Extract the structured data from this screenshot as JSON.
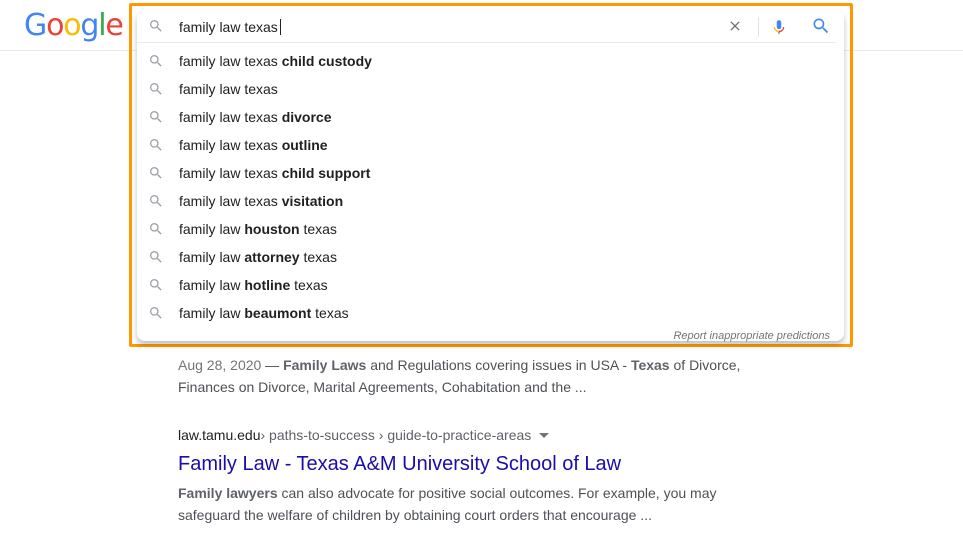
{
  "logo": {
    "text": "Google",
    "letters": [
      "G",
      "o",
      "o",
      "g",
      "l",
      "e"
    ]
  },
  "search": {
    "query": "family law texas ",
    "clear_icon": "close-icon",
    "voice_icon": "mic-icon",
    "submit_icon": "search-icon"
  },
  "suggestions": [
    {
      "prefix": "family law texas ",
      "bold": "child custody",
      "suffix": ""
    },
    {
      "prefix": "family law texas",
      "bold": "",
      "suffix": ""
    },
    {
      "prefix": "family law texas ",
      "bold": "divorce",
      "suffix": ""
    },
    {
      "prefix": "family law texas ",
      "bold": "outline",
      "suffix": ""
    },
    {
      "prefix": "family law texas ",
      "bold": "child support",
      "suffix": ""
    },
    {
      "prefix": "family law texas ",
      "bold": "visitation",
      "suffix": ""
    },
    {
      "prefix": "family law ",
      "bold": "houston",
      "suffix": " texas"
    },
    {
      "prefix": "family law ",
      "bold": "attorney",
      "suffix": " texas"
    },
    {
      "prefix": "family law ",
      "bold": "hotline",
      "suffix": " texas"
    },
    {
      "prefix": "family law ",
      "bold": "beaumont",
      "suffix": " texas"
    }
  ],
  "report_link": "Report inappropriate predictions",
  "results": [
    {
      "date": "Aug 28, 2020",
      "dash": " — ",
      "snippet_parts": [
        {
          "b": true,
          "t": "Family Laws"
        },
        {
          "b": false,
          "t": " and Regulations covering issues in USA - "
        },
        {
          "b": true,
          "t": "Texas"
        },
        {
          "b": false,
          "t": " of Divorce, Finances on Divorce, Marital Agreements, Cohabitation and the ..."
        }
      ]
    },
    {
      "cite_domain": "law.tamu.edu",
      "cite_path": " › paths-to-success › guide-to-practice-areas",
      "title": "Family Law - Texas A&M University School of Law",
      "snippet_parts": [
        {
          "b": true,
          "t": "Family lawyers"
        },
        {
          "b": false,
          "t": " can also advocate for positive social outcomes. For example, you may safeguard the welfare of children by obtaining court orders that encourage ..."
        }
      ]
    }
  ],
  "colors": {
    "highlight": "#FF9800",
    "link": "#1a0dab",
    "google_blue": "#4285F4",
    "google_red": "#EA4335",
    "google_yellow": "#FBBC05",
    "google_green": "#34A853"
  }
}
